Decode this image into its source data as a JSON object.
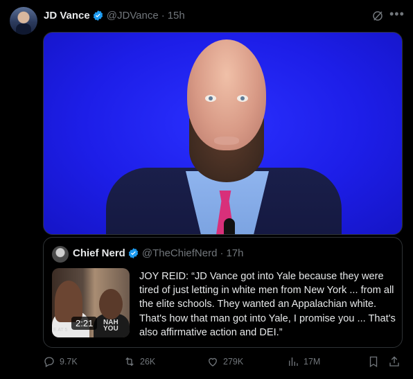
{
  "tweet": {
    "author_name": "JD Vance",
    "handle": "@JDVance",
    "separator": "·",
    "time": "15h"
  },
  "quoted": {
    "author_name": "Chief Nerd",
    "handle": "@TheChiefNerd",
    "separator": "·",
    "time": "17h",
    "video_duration": "2:21",
    "thumb_text_1": "NAH",
    "thumb_text_2": "YOU",
    "thumb_corner": "E AT 5",
    "text": "JOY REID: “JD Vance got into Yale because they were tired of just letting in white men from New York ... from all the elite schools. They wanted an Appalachian white. That's how that man got into Yale, I promise you ... That's also affirmative action and DEI.”"
  },
  "actions": {
    "replies": "9.7K",
    "reposts": "26K",
    "likes": "279K",
    "views": "17M"
  },
  "colors": {
    "background": "#000000",
    "verified": "#1d9bf0",
    "muted": "#71767b",
    "text": "#e7e9ea",
    "border": "#2f3336"
  }
}
